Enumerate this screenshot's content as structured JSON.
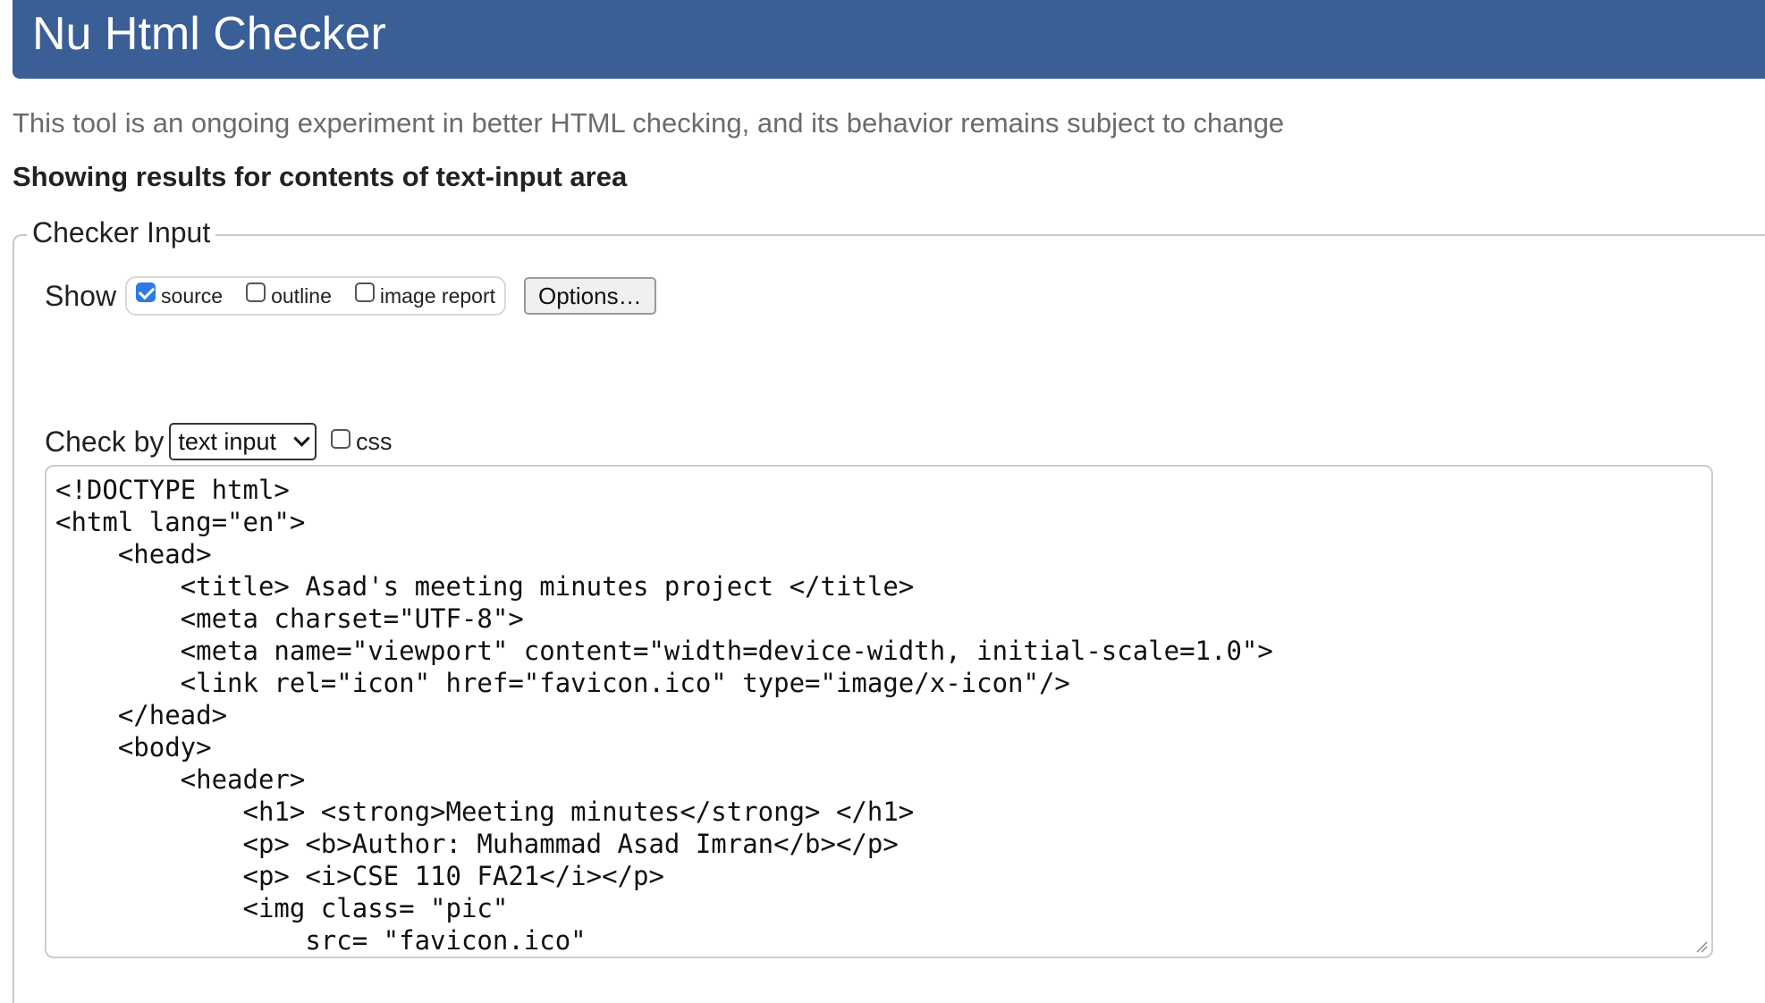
{
  "header": {
    "title": "Nu Html Checker"
  },
  "intro_text": "This tool is an ongoing experiment in better HTML checking, and its behavior remains subject to change",
  "results_heading": "Showing results for contents of text-input area",
  "checker_input": {
    "legend": "Checker Input",
    "show_label": "Show",
    "show_options": [
      {
        "label": "source",
        "checked": true
      },
      {
        "label": "outline",
        "checked": false
      },
      {
        "label": "image report",
        "checked": false
      }
    ],
    "options_button": "Options…",
    "check_by_label": "Check by",
    "check_by_value": "text input",
    "css_label": "css",
    "css_checked": false
  },
  "code_lines": [
    "<!DOCTYPE html>",
    "<html lang=\"en\">",
    "    <head>",
    "        <title> Asad's meeting minutes project </title>",
    "        <meta charset=\"UTF-8\">",
    "        <meta name=\"viewport\" content=\"width=device-width, initial-scale=1.0\">",
    "        <link rel=\"icon\" href=\"favicon.ico\" type=\"image/x-icon\"/>",
    "    </head>",
    "    <body>",
    "        <header>",
    "            <h1> <strong>Meeting minutes</strong> </h1>",
    "            <p> <b>Author: Muhammad Asad Imran</b></p>",
    "            <p> <i>CSE 110 FA21</i></p>",
    "            <img class= \"pic\"",
    "                src= \"favicon.ico\""
  ],
  "colors": {
    "header_bg": "#3a5f97",
    "header_text": "#ffffff",
    "checkbox_checked": "#2f7ae5",
    "intro_text": "#6b6b6b"
  }
}
